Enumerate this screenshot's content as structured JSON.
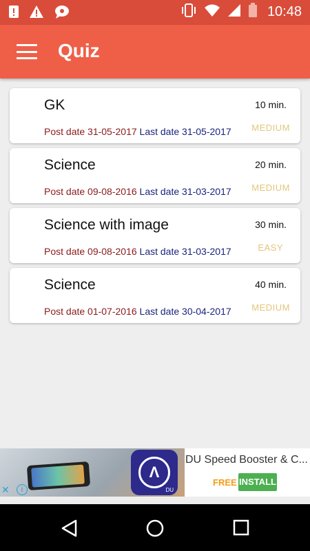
{
  "status_bar": {
    "time": "10:48",
    "icons": [
      "sim-alert-icon",
      "warning-icon",
      "notification-icon",
      "vibrate-icon",
      "wifi-icon",
      "signal-icon",
      "battery-icon"
    ]
  },
  "app_bar": {
    "title": "Quiz",
    "color": "#ef5f48"
  },
  "quizzes": [
    {
      "title": "GK",
      "duration": "10 min.",
      "post_date": "Post date 31-05-2017",
      "last_date": "Last date 31-05-2017",
      "level": "MEDIUM"
    },
    {
      "title": "Science",
      "duration": "20 min.",
      "post_date": "Post date 09-08-2016",
      "last_date": "Last date 31-03-2017",
      "level": "MEDIUM"
    },
    {
      "title": "Science with image",
      "duration": "30 min.",
      "post_date": "Post date 09-08-2016",
      "last_date": "Last date 31-03-2017",
      "level": "EASY"
    },
    {
      "title": "Science",
      "duration": "40 min.",
      "post_date": "Post date 01-07-2016",
      "last_date": "Last date 30-04-2017",
      "level": "MEDIUM"
    }
  ],
  "ad": {
    "title": "DU Speed Booster & C...",
    "free_label": "FREE",
    "install_label": "INSTALL"
  },
  "colors": {
    "post_date": "#8b1a1a",
    "last_date": "#1a237e",
    "level": "#e1c67a"
  }
}
